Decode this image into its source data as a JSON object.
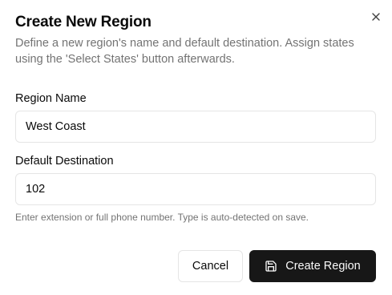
{
  "dialog": {
    "title": "Create New Region",
    "description": "Define a new region's name and default destination. Assign states using the 'Select States' button afterwards.",
    "close_icon": "close-icon"
  },
  "form": {
    "region_name": {
      "label": "Region Name",
      "value": "West Coast"
    },
    "default_destination": {
      "label": "Default Destination",
      "value": "102",
      "hint": "Enter extension or full phone number. Type is auto-detected on save."
    }
  },
  "actions": {
    "cancel_label": "Cancel",
    "create_label": "Create Region",
    "create_icon": "save-icon"
  },
  "colors": {
    "primary_button": "#171717",
    "muted_text": "#737373",
    "border": "#e5e5e5"
  }
}
